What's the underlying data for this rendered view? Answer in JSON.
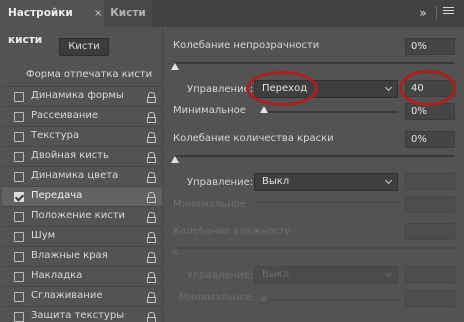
{
  "tabs": {
    "active": "Настройки кисти",
    "close": "×",
    "inactive": "Кисти",
    "overflow": "»"
  },
  "left": {
    "presets_button": "Кисти",
    "header": "Форма отпечатка кисти",
    "items": [
      {
        "label": "Динамика формы",
        "checked": false
      },
      {
        "label": "Рассеивание",
        "checked": false
      },
      {
        "label": "Текстура",
        "checked": false
      },
      {
        "label": "Двойная кисть",
        "checked": false
      },
      {
        "label": "Динамика цвета",
        "checked": false
      },
      {
        "label": "Передача",
        "checked": true
      },
      {
        "label": "Положение кисти",
        "checked": false
      },
      {
        "label": "Шум",
        "checked": false
      },
      {
        "label": "Влажные края",
        "checked": false
      },
      {
        "label": "Накладка",
        "checked": false
      },
      {
        "label": "Сглаживание",
        "checked": false
      },
      {
        "label": "Защита текстуры",
        "checked": false
      }
    ]
  },
  "right": {
    "opacity_jitter": {
      "label": "Колебание непрозрачности",
      "value": "0%",
      "slider_fraction": 0.0
    },
    "opacity_control": {
      "label": "Управление:",
      "selected": "Переход",
      "step_value": "40"
    },
    "opacity_minimum": {
      "label": "Минимальное",
      "value": "0%",
      "slider_fraction": 0.0
    },
    "flow_jitter": {
      "label": "Колебание количества краски",
      "value": "0%",
      "slider_fraction": 0.0
    },
    "flow_control": {
      "label": "Управление:",
      "selected": "Выкл"
    },
    "flow_minimum": {
      "label": "Минимальное"
    },
    "wetness_jitter": {
      "label": "Колебание влажности"
    },
    "wetness_control": {
      "label": "Управление:",
      "selected": "Выкл"
    },
    "wetness_minimum": {
      "label": "Минимальное"
    }
  },
  "colors": {
    "panel": "#535353",
    "tabbar": "#424242",
    "annotation_ring": "#b01e1e",
    "selected_row": "#636363"
  }
}
